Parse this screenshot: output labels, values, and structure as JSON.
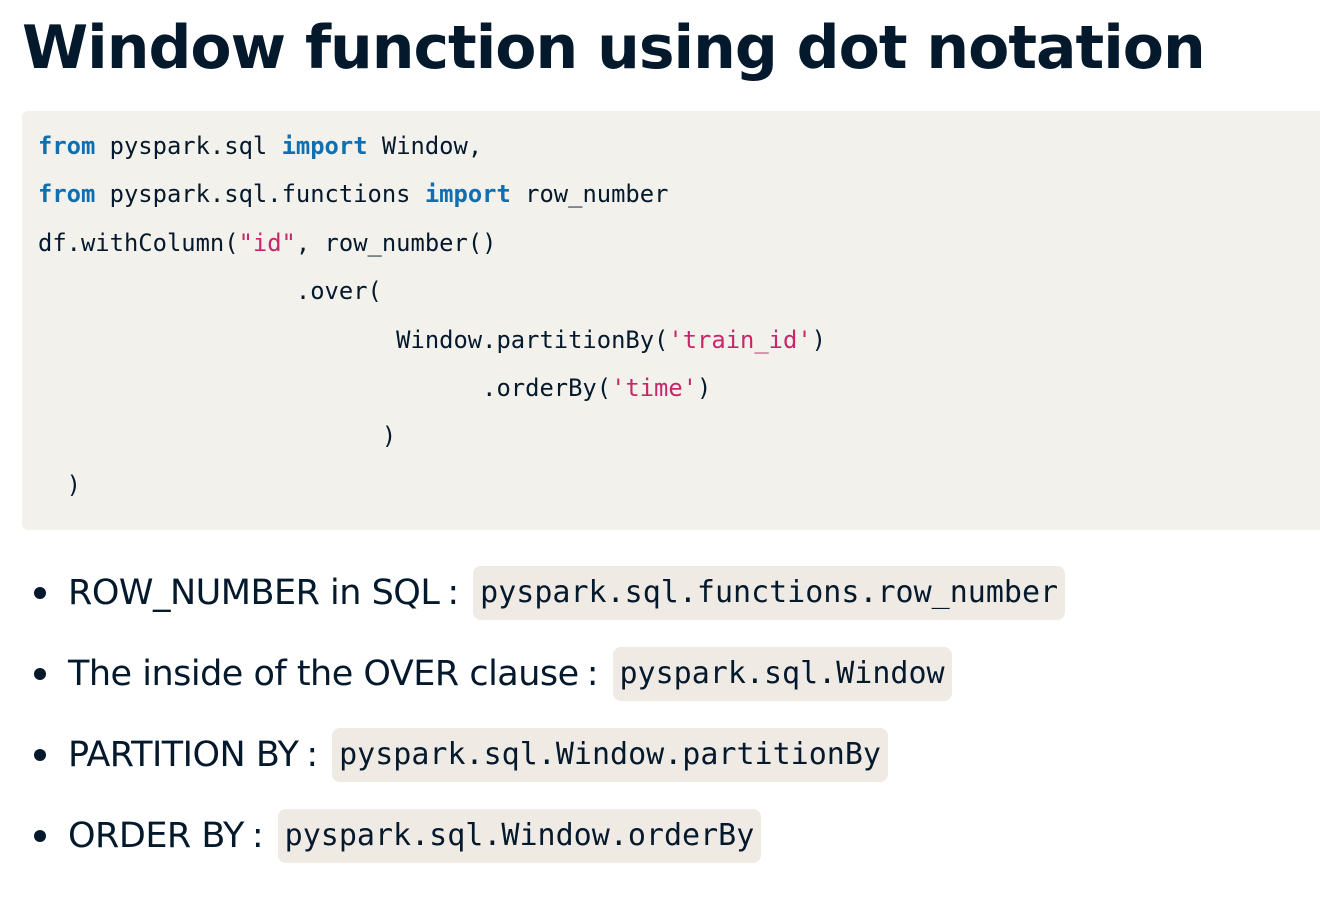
{
  "slide": {
    "title": "Window function using dot notation"
  },
  "code": {
    "lines": [
      [
        {
          "t": "from",
          "c": "kw"
        },
        {
          "t": " pyspark.sql ",
          "c": ""
        },
        {
          "t": "import",
          "c": "kw"
        },
        {
          "t": " Window,",
          "c": ""
        }
      ],
      [
        {
          "t": "from",
          "c": "kw"
        },
        {
          "t": " pyspark.sql.functions ",
          "c": ""
        },
        {
          "t": "import",
          "c": "kw"
        },
        {
          "t": " row_number",
          "c": ""
        }
      ],
      [
        {
          "t": "df.withColumn(",
          "c": ""
        },
        {
          "t": "\"id\"",
          "c": "str"
        },
        {
          "t": ", row_number()",
          "c": ""
        }
      ],
      [
        {
          "t": "                  .over(",
          "c": ""
        }
      ],
      [
        {
          "t": "                         Window.partitionBy(",
          "c": ""
        },
        {
          "t": "'train_id'",
          "c": "str"
        },
        {
          "t": ")",
          "c": ""
        }
      ],
      [
        {
          "t": "                               .orderBy(",
          "c": ""
        },
        {
          "t": "'time'",
          "c": "str"
        },
        {
          "t": ")",
          "c": ""
        }
      ],
      [
        {
          "t": "                        )",
          "c": ""
        }
      ],
      [
        {
          "t": "  )",
          "c": ""
        }
      ]
    ]
  },
  "bullets": [
    {
      "label": "ROW_NUMBER in SQL",
      "sep": ":",
      "code": "pyspark.sql.functions.row_number"
    },
    {
      "label": "The inside of the OVER clause",
      "sep": ":",
      "code": "pyspark.sql.Window"
    },
    {
      "label": "PARTITION BY",
      "sep": ":",
      "code": "pyspark.sql.Window.partitionBy"
    },
    {
      "label": "ORDER BY",
      "sep": ":",
      "code": "pyspark.sql.Window.orderBy"
    }
  ]
}
